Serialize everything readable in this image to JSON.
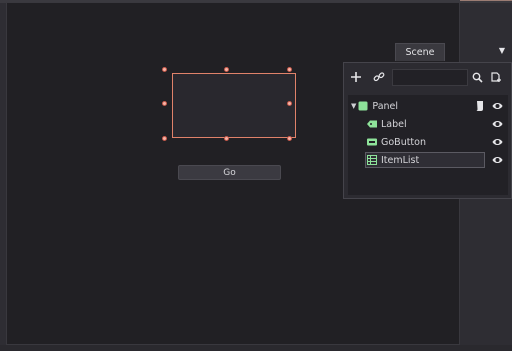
{
  "viewport": {
    "go_button_label": "Go"
  },
  "scene_dock": {
    "tab_label": "Scene",
    "filter_value": "",
    "filter_placeholder": "",
    "tree": [
      {
        "label": "Panel",
        "icon": "panel-icon",
        "expanded": true
      },
      {
        "label": "Label",
        "icon": "label-node-icon"
      },
      {
        "label": "GoButton",
        "icon": "button-node-icon"
      },
      {
        "label": "ItemList",
        "icon": "itemlist-node-icon",
        "selected": true
      }
    ]
  },
  "colors": {
    "selection_outline": "#e0826a",
    "node_green": "#8ee39a",
    "handle": "#f7b3a6"
  }
}
